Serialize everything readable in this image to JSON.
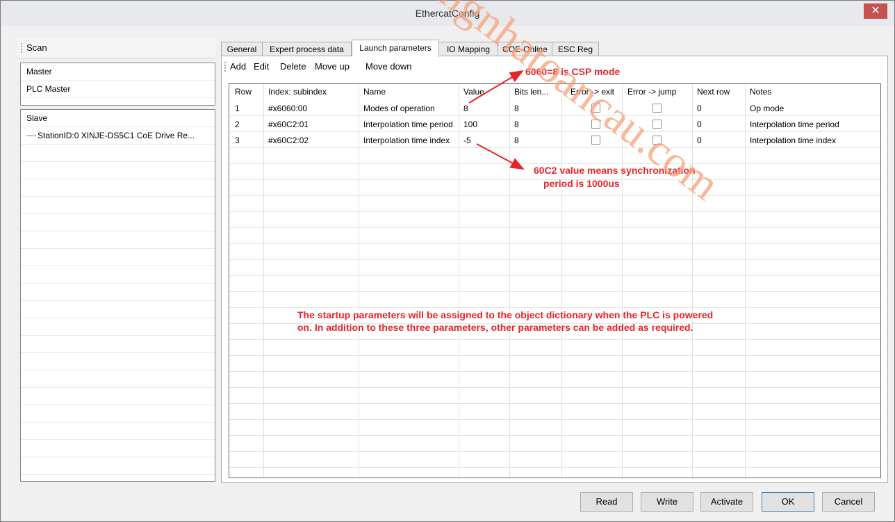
{
  "window": {
    "title": "EthercatConfig",
    "close_glyph": "✕"
  },
  "left_panel": {
    "scan_label": "Scan",
    "master_items": [
      "Master",
      "PLC Master"
    ],
    "slave_header": "Slave",
    "slave_items": [
      "StationID:0 XINJE-DS5C1 CoE Drive Re..."
    ]
  },
  "tabs": [
    {
      "label": "General",
      "active": false
    },
    {
      "label": "Expert process data",
      "active": false
    },
    {
      "label": "Launch parameters",
      "active": true
    },
    {
      "label": "IO Mapping",
      "active": false
    },
    {
      "label": "COE-Online",
      "active": false
    },
    {
      "label": "ESC Reg",
      "active": false
    }
  ],
  "toolbar": {
    "add": "Add",
    "edit": "Edit",
    "delete": "Delete",
    "move_up": "Move up",
    "move_down": "Move down"
  },
  "grid": {
    "columns": [
      "Row",
      "Index: subindex",
      "Name",
      "Value",
      "Bits len...",
      "Error -> exit",
      "Error -> jump",
      "Next row",
      "Notes"
    ],
    "rows": [
      {
        "row": "1",
        "index": "#x6060:00",
        "name": "Modes of operation",
        "value": "8",
        "bits": "8",
        "err_exit": false,
        "err_jump": false,
        "next": "0",
        "notes": "Op mode"
      },
      {
        "row": "2",
        "index": "#x60C2:01",
        "name": "Interpolation time period",
        "value": "100",
        "bits": "8",
        "err_exit": false,
        "err_jump": false,
        "next": "0",
        "notes": "Interpolation time period"
      },
      {
        "row": "3",
        "index": "#x60C2:02",
        "name": "Interpolation time index",
        "value": "-5",
        "bits": "8",
        "err_exit": false,
        "err_jump": false,
        "next": "0",
        "notes": "Interpolation time index"
      }
    ]
  },
  "annotations": {
    "csp": "6060=8 is CSP mode",
    "sync_line1": "60C2 value means synchronization",
    "sync_line2": "period is 1000us",
    "startup_line1": "The startup parameters will be assigned to the object dictionary when the PLC is powered",
    "startup_line2": "on. In addition to these three parameters, other parameters can be added as required.",
    "color": "#e8242b"
  },
  "footer": {
    "read": "Read",
    "write": "Write",
    "activate": "Activate",
    "ok": "OK",
    "cancel": "Cancel"
  },
  "watermark": {
    "text": "tongnhatoancau.com",
    "color": "#f5a07a"
  }
}
